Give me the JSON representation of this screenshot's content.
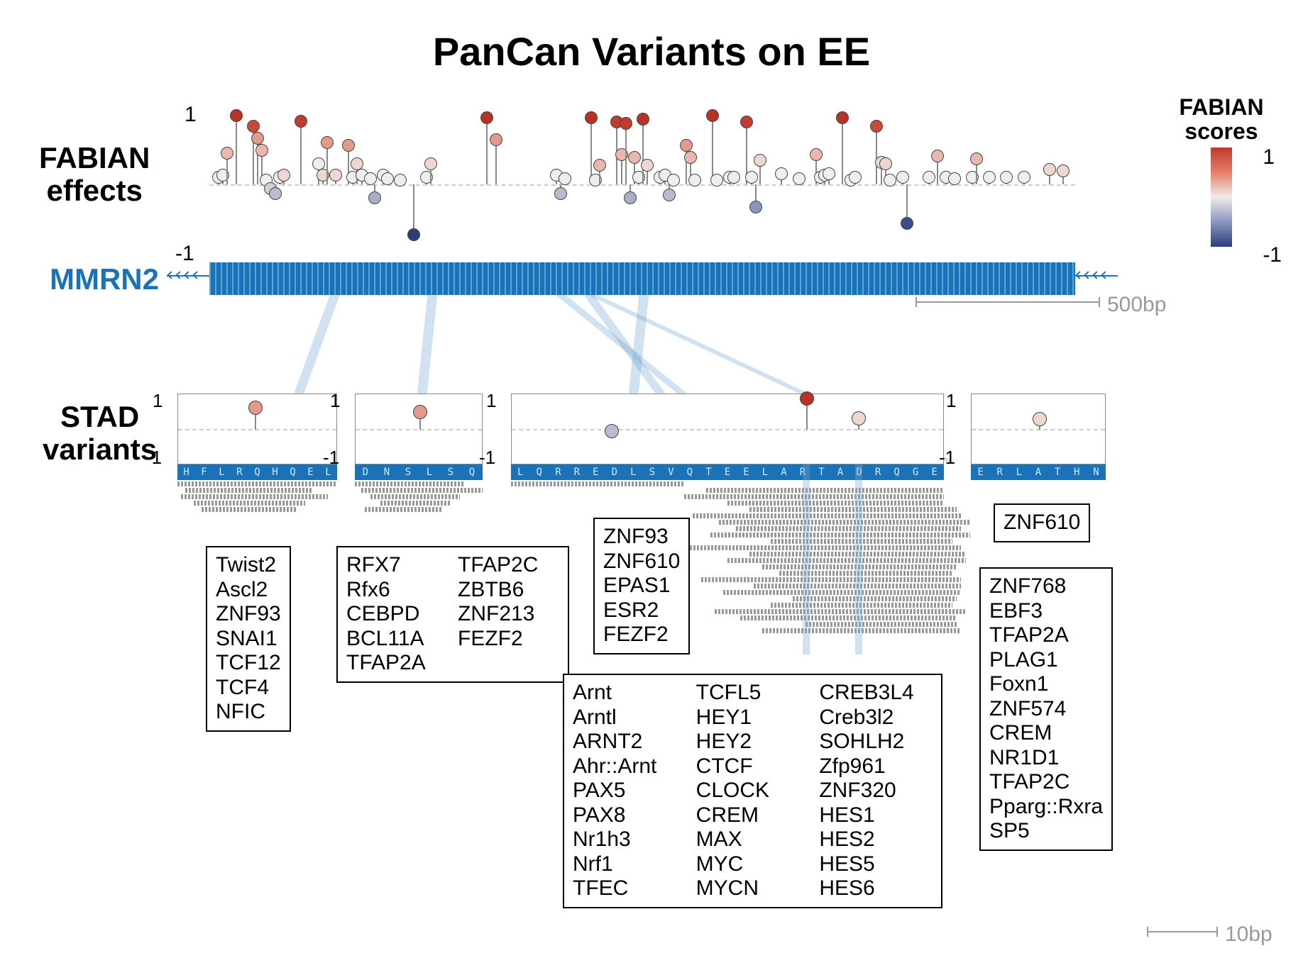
{
  "title": "PanCan Variants on EE",
  "labels": {
    "fabian": "FABIAN\neffects",
    "gene": "MMRN2",
    "stad": "STAD\nvariants"
  },
  "legend": {
    "title": "FABIAN\nscores",
    "max": "1",
    "min": "-1",
    "gradient_top_color": "#c0392b",
    "gradient_mid_color": "#f0ebe8",
    "gradient_bottom_color": "#2c3e7a"
  },
  "scale_top": "500bp",
  "scale_bottom": "10bp",
  "chart_data": {
    "type": "lollipop",
    "y_axis": {
      "min": -1,
      "max": 1,
      "ticks": [
        -1,
        1
      ]
    },
    "baseline": 0,
    "x_range_bp": 1000,
    "lollipops": [
      {
        "x_rel": 0.01,
        "score": 0.1,
        "col": "#eee"
      },
      {
        "x_rel": 0.015,
        "score": 0.12,
        "col": "#eee"
      },
      {
        "x_rel": 0.02,
        "score": 0.42,
        "col": "#e9b7ad"
      },
      {
        "x_rel": 0.03,
        "score": 0.92,
        "col": "#b83226"
      },
      {
        "x_rel": 0.05,
        "score": 0.78,
        "col": "#c94a3a"
      },
      {
        "x_rel": 0.055,
        "score": 0.62,
        "col": "#e39a8a"
      },
      {
        "x_rel": 0.06,
        "score": 0.46,
        "col": "#e9b7ad"
      },
      {
        "x_rel": 0.065,
        "score": 0.06,
        "col": "#eee"
      },
      {
        "x_rel": 0.07,
        "score": -0.06,
        "col": "#d0d0d8"
      },
      {
        "x_rel": 0.075,
        "score": -0.12,
        "col": "#b8bcd0"
      },
      {
        "x_rel": 0.08,
        "score": 0.1,
        "col": "#eee"
      },
      {
        "x_rel": 0.085,
        "score": 0.12,
        "col": "#eed7d0"
      },
      {
        "x_rel": 0.105,
        "score": 0.85,
        "col": "#c13c2e"
      },
      {
        "x_rel": 0.125,
        "score": 0.28,
        "col": "#eee"
      },
      {
        "x_rel": 0.13,
        "score": 0.12,
        "col": "#eed7d0"
      },
      {
        "x_rel": 0.135,
        "score": 0.56,
        "col": "#e39a8a"
      },
      {
        "x_rel": 0.145,
        "score": 0.12,
        "col": "#eed7d0"
      },
      {
        "x_rel": 0.16,
        "score": 0.52,
        "col": "#e39a8a"
      },
      {
        "x_rel": 0.165,
        "score": 0.1,
        "col": "#eee"
      },
      {
        "x_rel": 0.17,
        "score": 0.28,
        "col": "#eed7d0"
      },
      {
        "x_rel": 0.175,
        "score": 0.12,
        "col": "#eee"
      },
      {
        "x_rel": 0.185,
        "score": 0.08,
        "col": "#eee"
      },
      {
        "x_rel": 0.19,
        "score": -0.18,
        "col": "#a8afc8"
      },
      {
        "x_rel": 0.2,
        "score": 0.12,
        "col": "#eee"
      },
      {
        "x_rel": 0.205,
        "score": 0.08,
        "col": "#eee"
      },
      {
        "x_rel": 0.22,
        "score": 0.06,
        "col": "#eee"
      },
      {
        "x_rel": 0.235,
        "score": -0.68,
        "col": "#2c3e7a"
      },
      {
        "x_rel": 0.25,
        "score": 0.1,
        "col": "#eee"
      },
      {
        "x_rel": 0.255,
        "score": 0.28,
        "col": "#eed7d0"
      },
      {
        "x_rel": 0.32,
        "score": 0.9,
        "col": "#b83226"
      },
      {
        "x_rel": 0.33,
        "score": 0.6,
        "col": "#e39a8a"
      },
      {
        "x_rel": 0.4,
        "score": 0.12,
        "col": "#eee"
      },
      {
        "x_rel": 0.405,
        "score": -0.12,
        "col": "#b8bcd0"
      },
      {
        "x_rel": 0.41,
        "score": 0.08,
        "col": "#eee"
      },
      {
        "x_rel": 0.44,
        "score": 0.9,
        "col": "#b83226"
      },
      {
        "x_rel": 0.445,
        "score": 0.06,
        "col": "#eee"
      },
      {
        "x_rel": 0.45,
        "score": 0.26,
        "col": "#e9b7ad"
      },
      {
        "x_rel": 0.47,
        "score": 0.84,
        "col": "#c13c2e"
      },
      {
        "x_rel": 0.475,
        "score": 0.4,
        "col": "#e9b7ad"
      },
      {
        "x_rel": 0.48,
        "score": 0.82,
        "col": "#c13c2e"
      },
      {
        "x_rel": 0.485,
        "score": -0.18,
        "col": "#a8afc8"
      },
      {
        "x_rel": 0.49,
        "score": 0.36,
        "col": "#e9b7ad"
      },
      {
        "x_rel": 0.495,
        "score": 0.1,
        "col": "#eee"
      },
      {
        "x_rel": 0.5,
        "score": 0.88,
        "col": "#b83226"
      },
      {
        "x_rel": 0.505,
        "score": 0.26,
        "col": "#eed7d0"
      },
      {
        "x_rel": 0.52,
        "score": 0.1,
        "col": "#eee"
      },
      {
        "x_rel": 0.525,
        "score": 0.12,
        "col": "#eee"
      },
      {
        "x_rel": 0.53,
        "score": -0.14,
        "col": "#b8bcd0"
      },
      {
        "x_rel": 0.535,
        "score": 0.06,
        "col": "#eee"
      },
      {
        "x_rel": 0.55,
        "score": 0.52,
        "col": "#e39a8a"
      },
      {
        "x_rel": 0.555,
        "score": 0.36,
        "col": "#e9b7ad"
      },
      {
        "x_rel": 0.56,
        "score": 0.06,
        "col": "#eee"
      },
      {
        "x_rel": 0.58,
        "score": 0.92,
        "col": "#b83226"
      },
      {
        "x_rel": 0.585,
        "score": 0.06,
        "col": "#eee"
      },
      {
        "x_rel": 0.6,
        "score": 0.1,
        "col": "#eee"
      },
      {
        "x_rel": 0.605,
        "score": 0.1,
        "col": "#eee"
      },
      {
        "x_rel": 0.62,
        "score": 0.84,
        "col": "#c13c2e"
      },
      {
        "x_rel": 0.625,
        "score": 0.1,
        "col": "#eee"
      },
      {
        "x_rel": 0.63,
        "score": -0.3,
        "col": "#8a96c0"
      },
      {
        "x_rel": 0.635,
        "score": 0.32,
        "col": "#eed7d0"
      },
      {
        "x_rel": 0.66,
        "score": 0.14,
        "col": "#eee"
      },
      {
        "x_rel": 0.68,
        "score": 0.08,
        "col": "#eee"
      },
      {
        "x_rel": 0.7,
        "score": 0.4,
        "col": "#e9b7ad"
      },
      {
        "x_rel": 0.705,
        "score": 0.1,
        "col": "#eee"
      },
      {
        "x_rel": 0.71,
        "score": 0.12,
        "col": "#eee"
      },
      {
        "x_rel": 0.715,
        "score": 0.14,
        "col": "#eee"
      },
      {
        "x_rel": 0.73,
        "score": 0.9,
        "col": "#b83226"
      },
      {
        "x_rel": 0.74,
        "score": 0.06,
        "col": "#eee"
      },
      {
        "x_rel": 0.745,
        "score": 0.1,
        "col": "#eee"
      },
      {
        "x_rel": 0.77,
        "score": 0.78,
        "col": "#c94a3a"
      },
      {
        "x_rel": 0.775,
        "score": 0.3,
        "col": "#eed7d0"
      },
      {
        "x_rel": 0.78,
        "score": 0.28,
        "col": "#eed7d0"
      },
      {
        "x_rel": 0.785,
        "score": 0.06,
        "col": "#eee"
      },
      {
        "x_rel": 0.8,
        "score": 0.1,
        "col": "#eee"
      },
      {
        "x_rel": 0.805,
        "score": -0.52,
        "col": "#3a4d8a"
      },
      {
        "x_rel": 0.83,
        "score": 0.1,
        "col": "#eee"
      },
      {
        "x_rel": 0.84,
        "score": 0.38,
        "col": "#e9b7ad"
      },
      {
        "x_rel": 0.85,
        "score": 0.1,
        "col": "#eee"
      },
      {
        "x_rel": 0.86,
        "score": 0.08,
        "col": "#eee"
      },
      {
        "x_rel": 0.88,
        "score": 0.1,
        "col": "#eee"
      },
      {
        "x_rel": 0.885,
        "score": 0.34,
        "col": "#e9b7ad"
      },
      {
        "x_rel": 0.9,
        "score": 0.1,
        "col": "#eee"
      },
      {
        "x_rel": 0.92,
        "score": 0.1,
        "col": "#eee"
      },
      {
        "x_rel": 0.94,
        "score": 0.1,
        "col": "#eee"
      },
      {
        "x_rel": 0.97,
        "score": 0.2,
        "col": "#eed7d0"
      },
      {
        "x_rel": 0.985,
        "score": 0.18,
        "col": "#eed7d0"
      }
    ]
  },
  "stad_panels": [
    {
      "id": "p1",
      "seq": [
        "H",
        "F",
        "L",
        "R",
        "Q",
        "H",
        "Q",
        "E",
        "L"
      ],
      "points": [
        {
          "x_rel": 0.48,
          "score": 0.62,
          "col": "#e39a8a"
        }
      ],
      "reads": [
        {
          "l": 0.0,
          "w": 1.0
        },
        {
          "l": 0.05,
          "w": 0.8
        },
        {
          "l": 0.02,
          "w": 0.92
        },
        {
          "l": 0.1,
          "w": 0.7
        },
        {
          "l": 0.15,
          "w": 0.6
        }
      ],
      "tfs": [
        "Twist2",
        "Ascl2",
        "ZNF93",
        "SNAI1",
        "TCF12",
        "TCF4",
        "NFIC"
      ],
      "tf_cols": 1
    },
    {
      "id": "p2",
      "seq": [
        "D",
        "N",
        "S",
        "L",
        "S",
        "Q"
      ],
      "points": [
        {
          "x_rel": 0.5,
          "score": 0.5,
          "col": "#e39a8a"
        }
      ],
      "reads": [
        {
          "l": 0.0,
          "w": 0.85
        },
        {
          "l": 0.05,
          "w": 0.95
        },
        {
          "l": 0.12,
          "w": 0.7
        },
        {
          "l": 0.2,
          "w": 0.55
        },
        {
          "l": 0.08,
          "w": 0.6
        }
      ],
      "tfs": [
        "RFX7",
        "Rfx6",
        "CEBPD",
        "BCL11A",
        "TFAP2A",
        "TFAP2C",
        "ZBTB6",
        "ZNF213",
        "FEZF2"
      ],
      "tf_cols": 2
    },
    {
      "id": "p3",
      "seq": [
        "L",
        "Q",
        "R",
        "R",
        "E",
        "D",
        "L",
        "S",
        "V",
        "Q",
        "T",
        "E",
        "E",
        "L",
        "A",
        "R",
        "T",
        "A",
        "D",
        "R",
        "Q",
        "G",
        "E"
      ],
      "points": [
        {
          "x_rel": 0.23,
          "score": -0.04,
          "col": "#b8bcd0"
        },
        {
          "x_rel": 0.68,
          "score": 0.88,
          "col": "#b83226"
        },
        {
          "x_rel": 0.8,
          "score": 0.32,
          "col": "#eed7d0"
        }
      ],
      "reads": [
        {
          "l": 0.0,
          "w": 0.4
        },
        {
          "l": 0.45,
          "w": 0.55
        },
        {
          "l": 0.4,
          "w": 0.6
        },
        {
          "l": 0.5,
          "w": 0.5
        },
        {
          "l": 0.55,
          "w": 0.48
        },
        {
          "l": 0.42,
          "w": 0.62
        },
        {
          "l": 0.48,
          "w": 0.58
        },
        {
          "l": 0.52,
          "w": 0.52
        },
        {
          "l": 0.46,
          "w": 0.6
        },
        {
          "l": 0.6,
          "w": 0.42
        },
        {
          "l": 0.38,
          "w": 0.66
        },
        {
          "l": 0.55,
          "w": 0.5
        },
        {
          "l": 0.5,
          "w": 0.55
        },
        {
          "l": 0.58,
          "w": 0.45
        },
        {
          "l": 0.62,
          "w": 0.4
        },
        {
          "l": 0.44,
          "w": 0.6
        },
        {
          "l": 0.56,
          "w": 0.48
        },
        {
          "l": 0.49,
          "w": 0.55
        },
        {
          "l": 0.65,
          "w": 0.38
        },
        {
          "l": 0.6,
          "w": 0.42
        },
        {
          "l": 0.47,
          "w": 0.58
        },
        {
          "l": 0.53,
          "w": 0.5
        },
        {
          "l": 0.68,
          "w": 0.35
        },
        {
          "l": 0.58,
          "w": 0.46
        }
      ],
      "tf_boxes": [
        {
          "tfs": [
            "ZNF93",
            "ZNF610",
            "EPAS1",
            "ESR2",
            "FEZF2"
          ],
          "cols": 1
        },
        {
          "tfs": [
            "Arnt",
            "Arntl",
            "ARNT2",
            "Ahr::Arnt",
            "PAX5",
            "PAX8",
            "Nr1h3",
            "Nrf1",
            "TFEC",
            "TCFL5",
            "HEY1",
            "HEY2",
            "CTCF",
            "CLOCK",
            "CREM",
            "MAX",
            "MYC",
            "MYCN",
            "CREB3L4",
            "Creb3l2",
            "SOHLH2",
            "Zfp961",
            "ZNF320",
            "HES1",
            "HES2",
            "HES5",
            "HES6"
          ],
          "cols": 3
        }
      ]
    },
    {
      "id": "p4",
      "seq": [
        "E",
        "R",
        "L",
        "A",
        "T",
        "H",
        "N"
      ],
      "points": [
        {
          "x_rel": 0.5,
          "score": 0.3,
          "col": "#eed7d0"
        }
      ],
      "reads": [],
      "tfs": [
        "ZNF610"
      ],
      "tf_cols": 1,
      "second_box": [
        "ZNF768",
        "EBF3",
        "TFAP2A",
        "PLAG1",
        "Foxn1",
        "ZNF574",
        "CREM",
        "NR1D1",
        "TFAP2C",
        "Pparg::Rxra",
        "SP5"
      ]
    }
  ]
}
